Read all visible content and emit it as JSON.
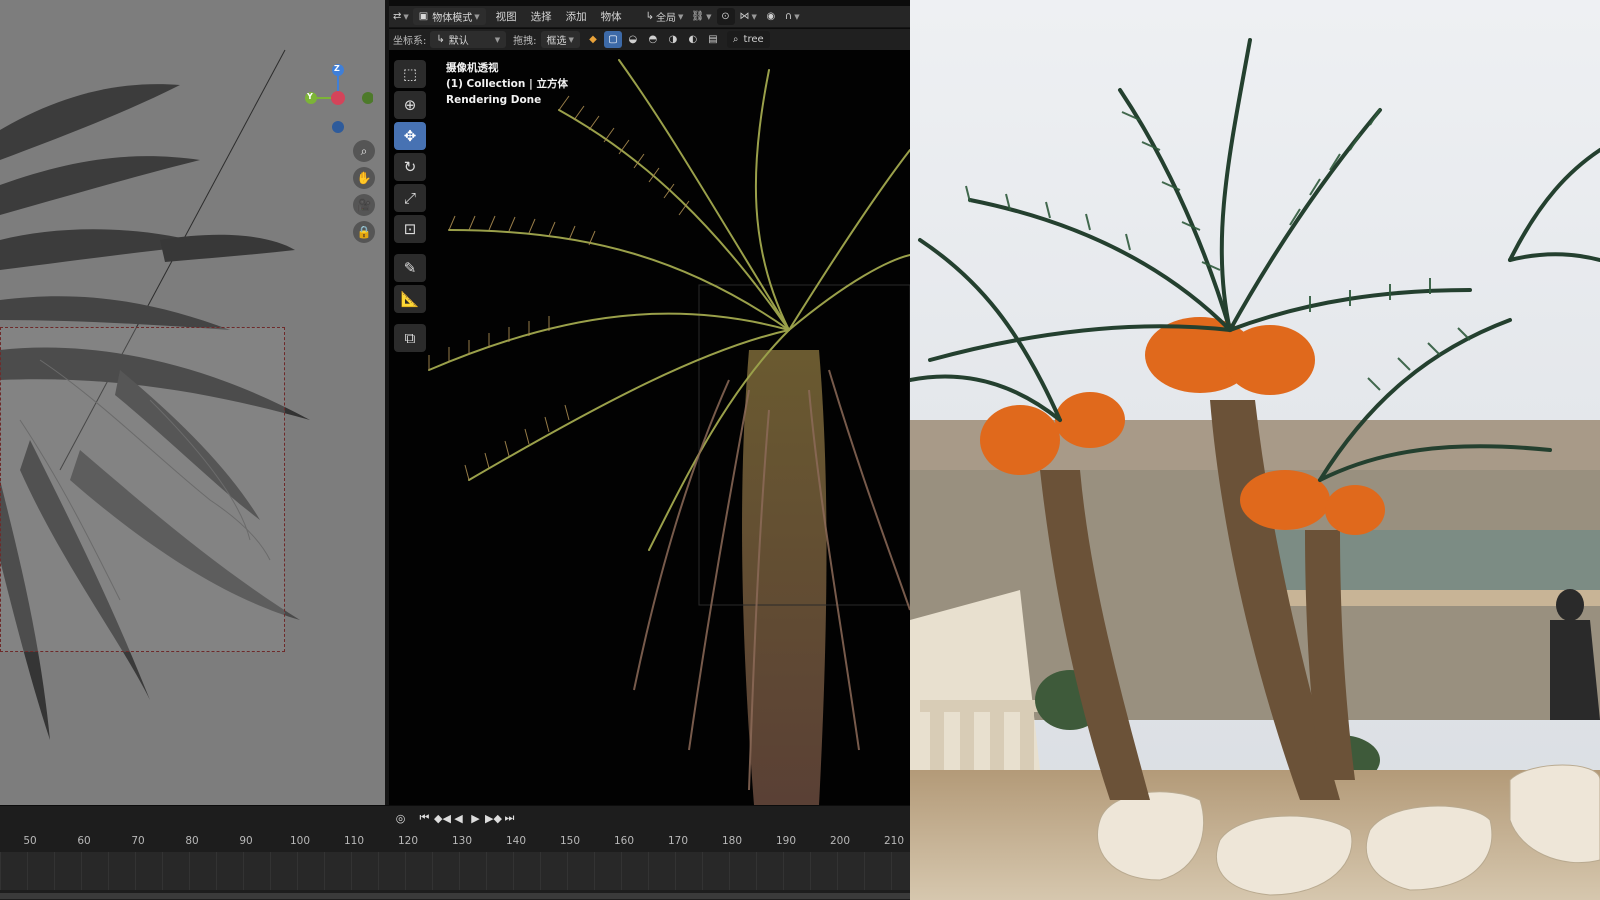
{
  "left_header": {
    "scope_label": "全局",
    "search_value": "tree"
  },
  "main_header": {
    "mode_label": "物体模式",
    "menu_items": [
      "视图",
      "选择",
      "添加",
      "物体"
    ],
    "transform_scope": "全局"
  },
  "tool_settings": {
    "orientation_label": "坐标系:",
    "orientation_value": "默认",
    "drag_label": "拖拽:",
    "drag_value": "框选",
    "search_value": "tree"
  },
  "gizmo": {
    "z_label": "Z",
    "y_label": "Y"
  },
  "viewport_info": {
    "view_name": "摄像机透视",
    "collection_line": "(1) Collection | 立方体",
    "status": "Rendering Done"
  },
  "timeline": {
    "frames": [
      "50",
      "60",
      "70",
      "80",
      "90",
      "100",
      "110",
      "120",
      "130",
      "140",
      "150",
      "160",
      "170",
      "180",
      "190",
      "200",
      "210"
    ]
  },
  "icons": {
    "tools": [
      "select-box-icon",
      "cursor-icon",
      "move-icon",
      "rotate-icon",
      "scale-icon",
      "transform-icon",
      "annotate-icon",
      "measure-icon",
      "add-cube-icon"
    ],
    "nav": [
      "zoom-icon",
      "hand-pan-icon",
      "camera-icon",
      "lock-icon"
    ]
  },
  "colors": {
    "header_bg": "#262626",
    "active_blue": "#4772b3",
    "solid_view_bg": "#7a7a7a",
    "render_bg": "#020202",
    "gizmo_x": "#d4445a",
    "gizmo_y": "#7cb437",
    "gizmo_z": "#3f7fd8"
  }
}
